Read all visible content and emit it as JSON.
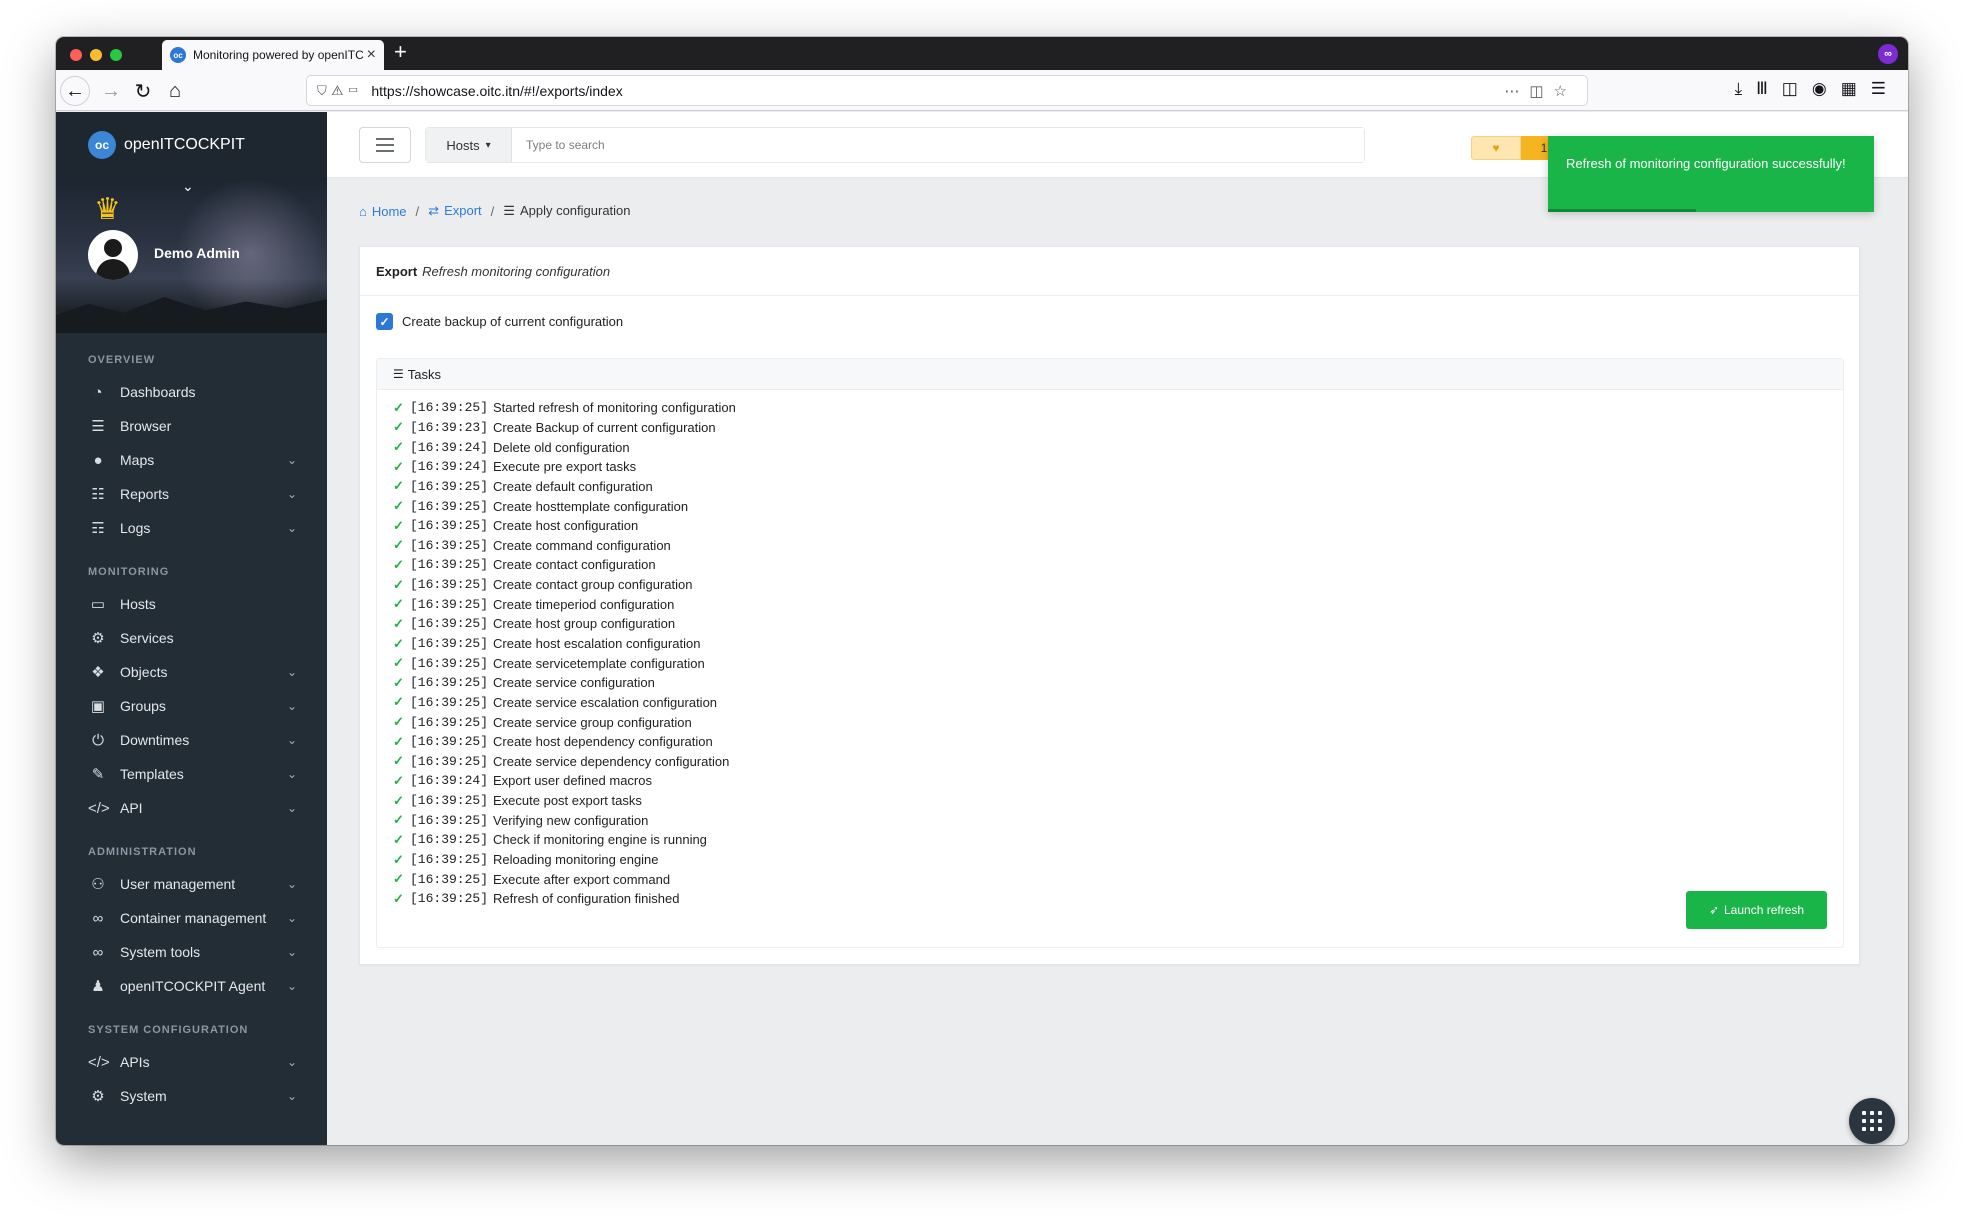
{
  "browser": {
    "tab_title": "Monitoring powered by openITC",
    "favicon_text": "oc",
    "url": "https://showcase.oitc.itn/#!/exports/index",
    "profile_badge": "∞"
  },
  "brand": {
    "logo_text": "oc",
    "name": "openITCOCKPIT"
  },
  "profile": {
    "name": "Demo Admin"
  },
  "sidebar": {
    "sections": [
      {
        "title": "OVERVIEW",
        "items": [
          {
            "label": "Dashboards",
            "icon": "tachometer-icon",
            "glyph": "◔",
            "chevron": false
          },
          {
            "label": "Browser",
            "icon": "list-icon",
            "glyph": "☰",
            "chevron": false
          },
          {
            "label": "Maps",
            "icon": "map-marker-icon",
            "glyph": "●",
            "chevron": true
          },
          {
            "label": "Reports",
            "icon": "file-icon",
            "glyph": "☷",
            "chevron": true
          },
          {
            "label": "Logs",
            "icon": "file-text-icon",
            "glyph": "☶",
            "chevron": true
          }
        ]
      },
      {
        "title": "MONITORING",
        "items": [
          {
            "label": "Hosts",
            "icon": "desktop-icon",
            "glyph": "▭",
            "chevron": false
          },
          {
            "label": "Services",
            "icon": "cogs-icon",
            "glyph": "⚙",
            "chevron": false
          },
          {
            "label": "Objects",
            "icon": "cubes-icon",
            "glyph": "❖",
            "chevron": true
          },
          {
            "label": "Groups",
            "icon": "object-group-icon",
            "glyph": "▣",
            "chevron": true
          },
          {
            "label": "Downtimes",
            "icon": "power-icon",
            "glyph": "⏻",
            "chevron": true
          },
          {
            "label": "Templates",
            "icon": "edit-icon",
            "glyph": "✎",
            "chevron": true
          },
          {
            "label": "API",
            "icon": "code-icon",
            "glyph": "</>",
            "chevron": true
          }
        ]
      },
      {
        "title": "ADMINISTRATION",
        "items": [
          {
            "label": "User management",
            "icon": "users-icon",
            "glyph": "⚇",
            "chevron": true
          },
          {
            "label": "Container management",
            "icon": "link-icon",
            "glyph": "∞",
            "chevron": true
          },
          {
            "label": "System tools",
            "icon": "link-icon",
            "glyph": "∞",
            "chevron": true
          },
          {
            "label": "openITCOCKPIT Agent",
            "icon": "user-secret-icon",
            "glyph": "♟",
            "chevron": true
          }
        ]
      },
      {
        "title": "SYSTEM CONFIGURATION",
        "items": [
          {
            "label": "APIs",
            "icon": "code-icon",
            "glyph": "</>",
            "chevron": true
          },
          {
            "label": "System",
            "icon": "cogs-icon",
            "glyph": "⚙",
            "chevron": true
          }
        ]
      }
    ]
  },
  "topbar": {
    "search_type": "Hosts",
    "search_placeholder": "Type to search",
    "notification_count": "1"
  },
  "toast": {
    "message": "Refresh of monitoring configuration successfully!"
  },
  "breadcrumb": {
    "home": "Home",
    "export": "Export",
    "current": "Apply configuration"
  },
  "panel": {
    "title": "Export",
    "subtitle": "Refresh monitoring configuration",
    "checkbox_label": "Create backup of current configuration",
    "checkbox_checked": true,
    "tasks_title": "Tasks",
    "tasks": [
      {
        "time": "[16:39:25]",
        "text": "Started refresh of monitoring configuration"
      },
      {
        "time": "[16:39:23]",
        "text": "Create Backup of current configuration"
      },
      {
        "time": "[16:39:24]",
        "text": "Delete old configuration"
      },
      {
        "time": "[16:39:24]",
        "text": "Execute pre export tasks"
      },
      {
        "time": "[16:39:25]",
        "text": "Create default configuration"
      },
      {
        "time": "[16:39:25]",
        "text": "Create hosttemplate configuration"
      },
      {
        "time": "[16:39:25]",
        "text": "Create host configuration"
      },
      {
        "time": "[16:39:25]",
        "text": "Create command configuration"
      },
      {
        "time": "[16:39:25]",
        "text": "Create contact configuration"
      },
      {
        "time": "[16:39:25]",
        "text": "Create contact group configuration"
      },
      {
        "time": "[16:39:25]",
        "text": "Create timeperiod configuration"
      },
      {
        "time": "[16:39:25]",
        "text": "Create host group configuration"
      },
      {
        "time": "[16:39:25]",
        "text": "Create host escalation configuration"
      },
      {
        "time": "[16:39:25]",
        "text": "Create servicetemplate configuration"
      },
      {
        "time": "[16:39:25]",
        "text": "Create service configuration"
      },
      {
        "time": "[16:39:25]",
        "text": "Create service escalation configuration"
      },
      {
        "time": "[16:39:25]",
        "text": "Create service group configuration"
      },
      {
        "time": "[16:39:25]",
        "text": "Create host dependency configuration"
      },
      {
        "time": "[16:39:25]",
        "text": "Create service dependency configuration"
      },
      {
        "time": "[16:39:24]",
        "text": "Export user defined macros"
      },
      {
        "time": "[16:39:25]",
        "text": "Execute post export tasks"
      },
      {
        "time": "[16:39:25]",
        "text": "Verifying new configuration"
      },
      {
        "time": "[16:39:25]",
        "text": "Check if monitoring engine is running"
      },
      {
        "time": "[16:39:25]",
        "text": "Reloading monitoring engine"
      },
      {
        "time": "[16:39:25]",
        "text": "Execute after export command"
      },
      {
        "time": "[16:39:25]",
        "text": "Refresh of configuration finished"
      }
    ],
    "launch_label": "Launch refresh"
  },
  "colors": {
    "accent": "#2d78d6",
    "success": "#1ab548",
    "sidebar": "#222d36",
    "warning": "#f5b520"
  }
}
